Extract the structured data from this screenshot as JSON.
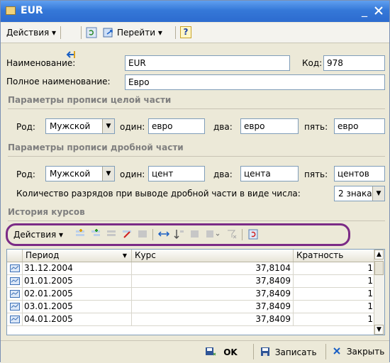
{
  "window": {
    "title": "EUR"
  },
  "toolbar": {
    "actions_label": "Действия",
    "goto_label": "Перейти",
    "help_label": "?"
  },
  "form": {
    "name_label": "Наименование:",
    "name_value": "EUR",
    "code_label": "Код:",
    "code_value": "978",
    "fullname_label": "Полное наименование:",
    "fullname_value": "Евро"
  },
  "whole_part": {
    "title": "Параметры прописи целой части",
    "gender_label": "Род:",
    "gender_value": "Мужской",
    "one_label": "один:",
    "one_value": "евро",
    "two_label": "два:",
    "two_value": "евро",
    "five_label": "пять:",
    "five_value": "евро"
  },
  "fraction_part": {
    "title": "Параметры прописи дробной части",
    "gender_label": "Род:",
    "gender_value": "Мужской",
    "one_label": "один:",
    "one_value": "цент",
    "two_label": "два:",
    "two_value": "цента",
    "five_label": "пять:",
    "five_value": "центов",
    "digits_label": "Количество разрядов при выводе дробной части в виде числа:",
    "digits_value": "2 знака"
  },
  "history": {
    "title": "История курсов",
    "actions_label": "Действия",
    "columns": [
      "Период",
      "Курс",
      "Кратность"
    ],
    "rows": [
      {
        "period": "31.12.2004",
        "rate": "37,8104",
        "mult": "1"
      },
      {
        "period": "01.01.2005",
        "rate": "37,8409",
        "mult": "1"
      },
      {
        "period": "02.01.2005",
        "rate": "37,8409",
        "mult": "1"
      },
      {
        "period": "03.01.2005",
        "rate": "37,8409",
        "mult": "1"
      },
      {
        "period": "04.01.2005",
        "rate": "37,8409",
        "mult": "1"
      }
    ]
  },
  "footer": {
    "ok_label": "OK",
    "save_label": "Записать",
    "close_label": "Закрыть"
  },
  "colors": {
    "title_bar": "#3578d8",
    "highlight": "#7b2b86",
    "section_text": "#7f7f7f"
  }
}
